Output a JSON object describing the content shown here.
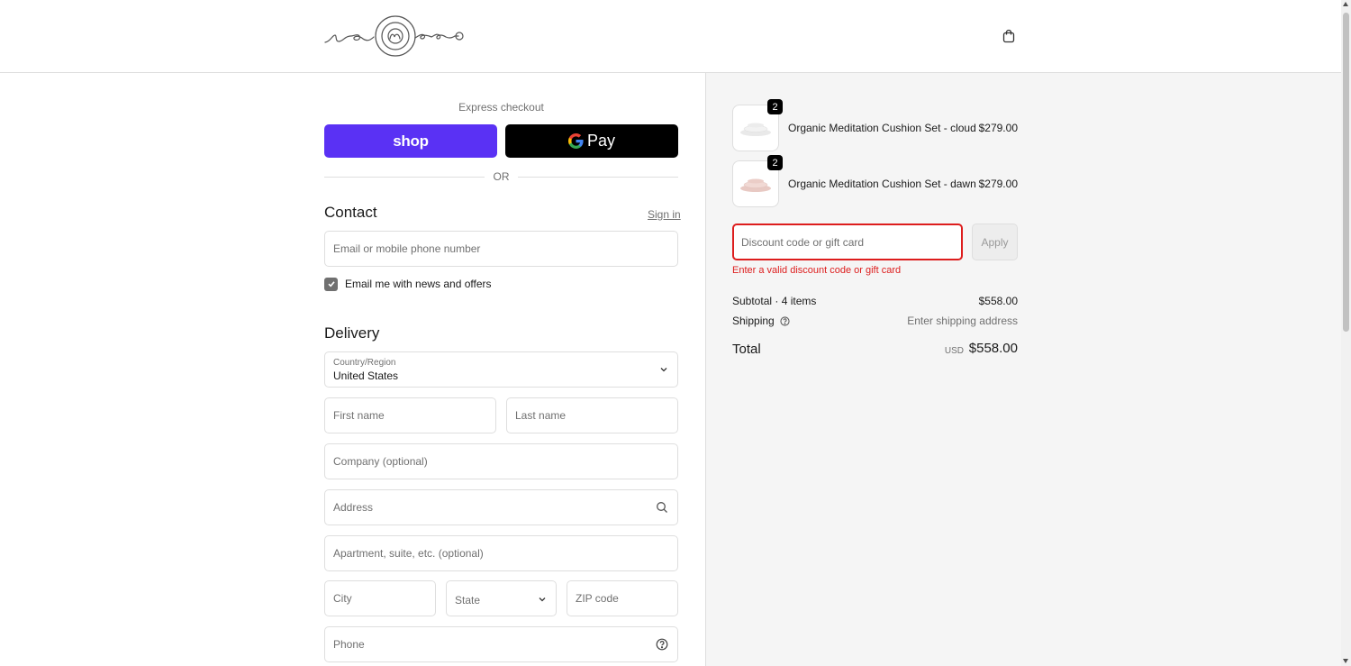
{
  "header": {
    "brand": "nenoo",
    "cart_icon": "shopping-bag-icon"
  },
  "express": {
    "label": "Express checkout",
    "shop_pay_label": "shop",
    "gpay_label": "Pay",
    "or_label": "OR"
  },
  "contact": {
    "title": "Contact",
    "sign_in": "Sign in",
    "email_placeholder": "Email or mobile phone number",
    "newsletter_label": "Email me with news and offers",
    "newsletter_checked": true
  },
  "delivery": {
    "title": "Delivery",
    "country_label": "Country/Region",
    "country_value": "United States",
    "first_name_placeholder": "First name",
    "last_name_placeholder": "Last name",
    "company_placeholder": "Company (optional)",
    "address_placeholder": "Address",
    "apartment_placeholder": "Apartment, suite, etc. (optional)",
    "city_placeholder": "City",
    "state_label": "State",
    "zip_placeholder": "ZIP code",
    "phone_placeholder": "Phone"
  },
  "cart": {
    "items": [
      {
        "name": "Organic Meditation Cushion Set - cloud",
        "price": "$279.00",
        "qty": "2",
        "color": "#e9e9e9"
      },
      {
        "name": "Organic Meditation Cushion Set - dawn",
        "price": "$279.00",
        "qty": "2",
        "color": "#e8c9c3"
      }
    ],
    "discount_placeholder": "Discount code or gift card",
    "apply_label": "Apply",
    "discount_error": "Enter a valid discount code or gift card",
    "subtotal_label": "Subtotal · 4 items",
    "subtotal_value": "$558.00",
    "shipping_label": "Shipping",
    "shipping_value": "Enter shipping address",
    "total_label": "Total",
    "total_currency": "USD",
    "total_value": "$558.00"
  },
  "colors": {
    "shop_pay": "#5a31f4",
    "gpay": "#000000",
    "error": "#dd1d1d",
    "summary_bg": "#f5f5f5"
  }
}
